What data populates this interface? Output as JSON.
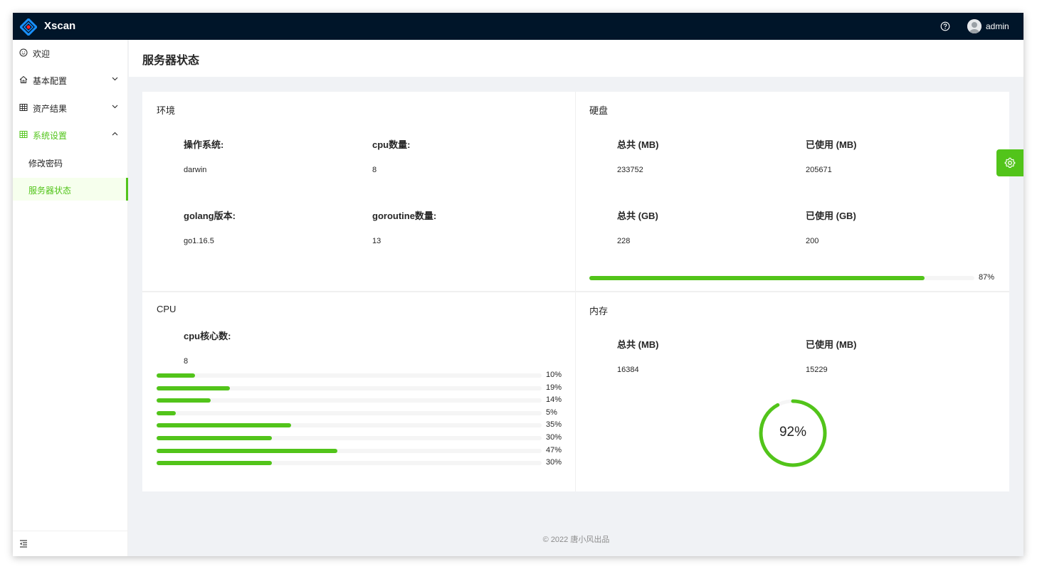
{
  "app": {
    "title": "Xscan",
    "username": "admin"
  },
  "sidebar": {
    "items": [
      {
        "label": "欢迎",
        "icon": "smile-icon"
      },
      {
        "label": "基本配置",
        "icon": "home-icon"
      },
      {
        "label": "资产结果",
        "icon": "table-icon"
      },
      {
        "label": "系统设置",
        "icon": "grid-icon"
      }
    ],
    "submenu": [
      {
        "label": "修改密码"
      },
      {
        "label": "服务器状态"
      }
    ]
  },
  "page": {
    "title": "服务器状态"
  },
  "env": {
    "title": "环境",
    "os_label": "操作系统:",
    "os_value": "darwin",
    "cpu_count_label": "cpu数量:",
    "cpu_count_value": "8",
    "golang_label": "golang版本:",
    "golang_value": "go1.16.5",
    "goroutine_label": "goroutine数量:",
    "goroutine_value": "13"
  },
  "disk": {
    "title": "硬盘",
    "total_mb_label": "总共 (MB)",
    "total_mb_value": "233752",
    "used_mb_label": "已使用 (MB)",
    "used_mb_value": "205671",
    "total_gb_label": "总共 (GB)",
    "total_gb_value": "228",
    "used_gb_label": "已使用 (GB)",
    "used_gb_value": "200",
    "percent": 87,
    "percent_label": "87%"
  },
  "cpu": {
    "title": "CPU",
    "cores_label": "cpu核心数:",
    "cores_value": "8",
    "usage": [
      {
        "percent": 10,
        "label": "10%"
      },
      {
        "percent": 19,
        "label": "19%"
      },
      {
        "percent": 14,
        "label": "14%"
      },
      {
        "percent": 5,
        "label": "5%"
      },
      {
        "percent": 35,
        "label": "35%"
      },
      {
        "percent": 30,
        "label": "30%"
      },
      {
        "percent": 47,
        "label": "47%"
      },
      {
        "percent": 30,
        "label": "30%"
      }
    ]
  },
  "memory": {
    "title": "内存",
    "total_mb_label": "总共 (MB)",
    "total_mb_value": "16384",
    "used_mb_label": "已使用 (MB)",
    "used_mb_value": "15229",
    "percent": 92,
    "percent_label": "92%"
  },
  "footer": {
    "text": "2022 唐小风出品"
  },
  "colors": {
    "accent": "#52c41a",
    "header_bg": "#001529",
    "track": "#f5f5f5"
  }
}
